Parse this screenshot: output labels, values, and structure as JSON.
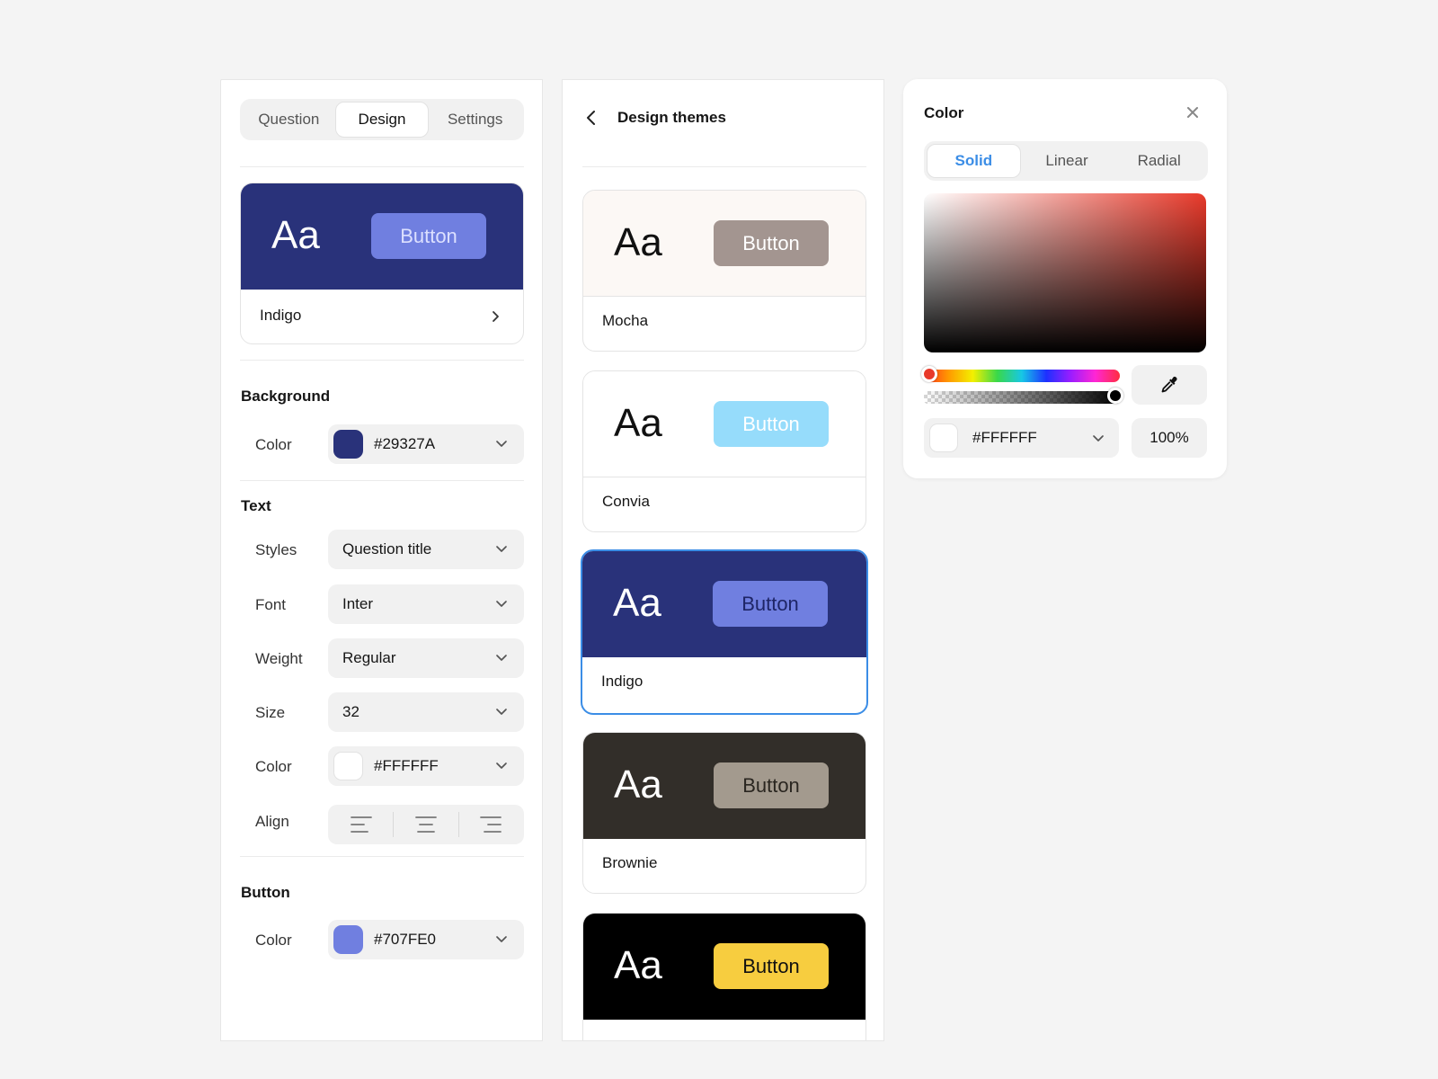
{
  "left_panel": {
    "tabs": [
      "Question",
      "Design",
      "Settings"
    ],
    "active_tab": "Design",
    "current_theme": {
      "name": "Indigo",
      "aa": "Aa",
      "button_label": "Button",
      "bg": "#29327A",
      "button_bg": "#707FE0",
      "aa_color": "#FFFFFF",
      "button_text_color": "#DCE0FF"
    },
    "background": {
      "title": "Background",
      "color_label": "Color",
      "color_value": "#29327A",
      "swatch": "#29327A"
    },
    "text": {
      "title": "Text",
      "styles_label": "Styles",
      "styles_value": "Question title",
      "font_label": "Font",
      "font_value": "Inter",
      "weight_label": "Weight",
      "weight_value": "Regular",
      "size_label": "Size",
      "size_value": "32",
      "color_label": "Color",
      "color_value": "#FFFFFF",
      "align_label": "Align"
    },
    "button": {
      "title": "Button",
      "color_label": "Color",
      "color_value": "#707FE0",
      "swatch": "#707FE0"
    }
  },
  "middle_panel": {
    "title": "Design themes",
    "themes": [
      {
        "name": "Mocha",
        "aa": "Aa",
        "button_label": "Button",
        "bg": "#FCF8F5",
        "aa_color": "#111111",
        "button_bg": "#A39590",
        "button_text_color": "#FFFFFF",
        "selected": false
      },
      {
        "name": "Convia",
        "aa": "Aa",
        "button_label": "Button",
        "bg": "#FFFFFF",
        "aa_color": "#111111",
        "button_bg": "#96DCFB",
        "button_text_color": "#FFFFFF",
        "selected": false
      },
      {
        "name": "Indigo",
        "aa": "Aa",
        "button_label": "Button",
        "bg": "#29327A",
        "aa_color": "#FFFFFF",
        "button_bg": "#707FE0",
        "button_text_color": "#1E2566",
        "selected": true
      },
      {
        "name": "Brownie",
        "aa": "Aa",
        "button_label": "Button",
        "bg": "#322E29",
        "aa_color": "#FFFFFF",
        "button_bg": "#A39A8E",
        "button_text_color": "#2A2620",
        "selected": false
      },
      {
        "name": "",
        "aa": "Aa",
        "button_label": "Button",
        "bg": "#000000",
        "aa_color": "#FFFFFF",
        "button_bg": "#F7CD3F",
        "button_text_color": "#111111",
        "selected": false
      }
    ]
  },
  "color_picker": {
    "title": "Color",
    "tabs": [
      "Solid",
      "Linear",
      "Radial"
    ],
    "active_tab": "Solid",
    "hex_value": "#FFFFFF",
    "opacity": "100%",
    "hue_color": "#E8392A"
  }
}
